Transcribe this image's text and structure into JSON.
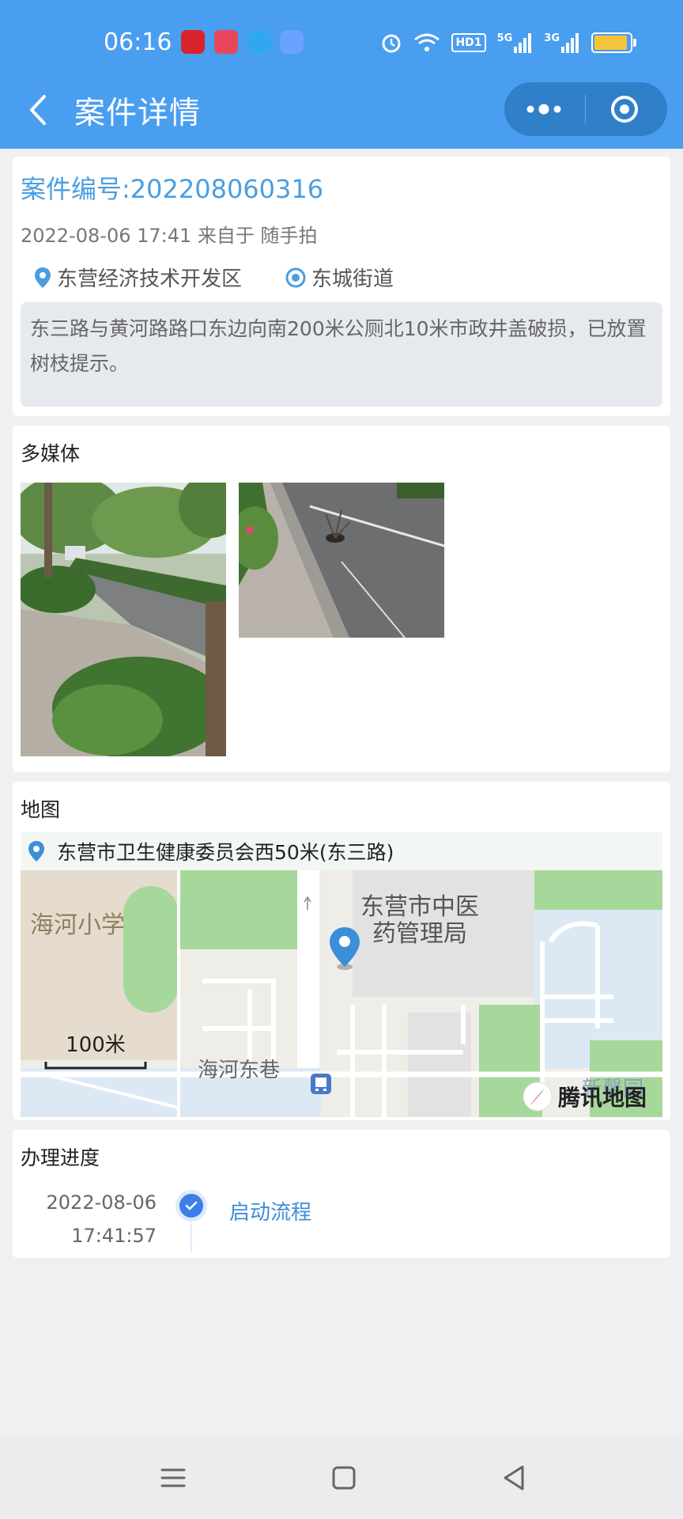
{
  "status_bar": {
    "time": "06:16",
    "icons": [
      "alarm-icon",
      "wifi-icon",
      "hd-icon",
      "signal-5g-icon",
      "signal-3g-icon",
      "battery-icon"
    ],
    "hd_label": "HD1",
    "net1": "5G",
    "net2": "3G"
  },
  "header": {
    "title": "案件详情",
    "back_icon": "chevron-left-icon",
    "more_icon": "more-dots-icon",
    "close_icon": "target-icon"
  },
  "case": {
    "number": "案件编号:202208060316",
    "meta": "2022-08-06 17:41 来自于 随手拍",
    "district": "东营经济技术开发区",
    "street": "东城街道",
    "description": "东三路与黄河路路口东边向南200米公厕北10米市政井盖破损，已放置树枝提示。"
  },
  "media": {
    "title": "多媒体",
    "photos": [
      "photo-1",
      "photo-2"
    ]
  },
  "map": {
    "title": "地图",
    "address": "东营市卫生健康委员会西50米(东三路)",
    "labels": {
      "school": "海河小学",
      "bureau_line1": "东营市中医",
      "bureau_line2": "药管理局",
      "lane": "海河东巷",
      "scale": "100米",
      "partial": "新馨园"
    },
    "provider": "腾讯地图"
  },
  "progress": {
    "title": "办理进度",
    "items": [
      {
        "date": "2022-08-06",
        "time": "17:41:57",
        "label": "启动流程"
      }
    ]
  },
  "colors": {
    "header_bg": "#4a9ef0",
    "accent": "#4a9ee0",
    "timeline_dot": "#3d7ee8"
  }
}
